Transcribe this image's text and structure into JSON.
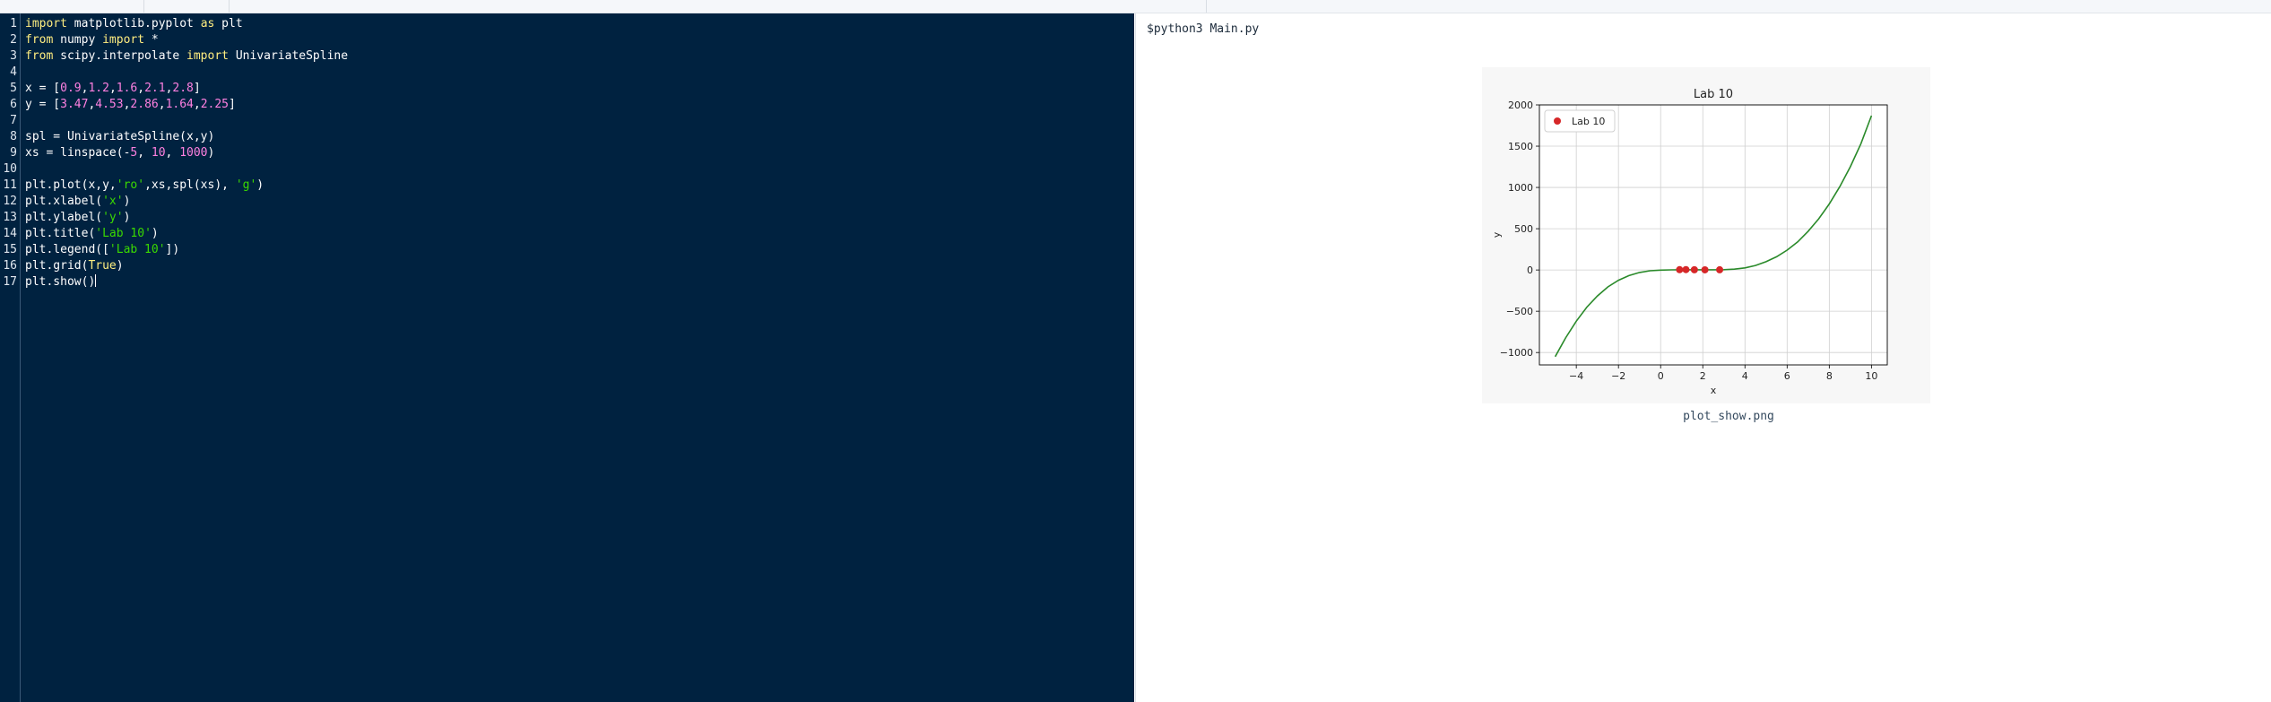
{
  "editor": {
    "lines": [
      [
        {
          "t": "import",
          "c": "kw"
        },
        {
          "t": " matplotlib.pyplot "
        },
        {
          "t": "as",
          "c": "kw"
        },
        {
          "t": " plt"
        }
      ],
      [
        {
          "t": "from",
          "c": "kw"
        },
        {
          "t": " numpy "
        },
        {
          "t": "import",
          "c": "kw"
        },
        {
          "t": " *"
        }
      ],
      [
        {
          "t": "from",
          "c": "kw"
        },
        {
          "t": " scipy.interpolate "
        },
        {
          "t": "import",
          "c": "kw"
        },
        {
          "t": " UnivariateSpline"
        }
      ],
      [],
      [
        {
          "t": "x = ["
        },
        {
          "t": "0.9",
          "c": "num"
        },
        {
          "t": ","
        },
        {
          "t": "1.2",
          "c": "num"
        },
        {
          "t": ","
        },
        {
          "t": "1.6",
          "c": "num"
        },
        {
          "t": ","
        },
        {
          "t": "2.1",
          "c": "num"
        },
        {
          "t": ","
        },
        {
          "t": "2.8",
          "c": "num"
        },
        {
          "t": "]"
        }
      ],
      [
        {
          "t": "y = ["
        },
        {
          "t": "3.47",
          "c": "num"
        },
        {
          "t": ","
        },
        {
          "t": "4.53",
          "c": "num"
        },
        {
          "t": ","
        },
        {
          "t": "2.86",
          "c": "num"
        },
        {
          "t": ","
        },
        {
          "t": "1.64",
          "c": "num"
        },
        {
          "t": ","
        },
        {
          "t": "2.25",
          "c": "num"
        },
        {
          "t": "]"
        }
      ],
      [],
      [
        {
          "t": "spl = UnivariateSpline(x,y)"
        }
      ],
      [
        {
          "t": "xs = linspace(-"
        },
        {
          "t": "5",
          "c": "num"
        },
        {
          "t": ", "
        },
        {
          "t": "10",
          "c": "num"
        },
        {
          "t": ", "
        },
        {
          "t": "1000",
          "c": "num"
        },
        {
          "t": ")"
        }
      ],
      [],
      [
        {
          "t": "plt.plot(x,y,"
        },
        {
          "t": "'ro'",
          "c": "str"
        },
        {
          "t": ",xs,spl(xs), "
        },
        {
          "t": "'g'",
          "c": "str"
        },
        {
          "t": ")"
        }
      ],
      [
        {
          "t": "plt.xlabel("
        },
        {
          "t": "'x'",
          "c": "str"
        },
        {
          "t": ")"
        }
      ],
      [
        {
          "t": "plt.ylabel("
        },
        {
          "t": "'y'",
          "c": "str"
        },
        {
          "t": ")"
        }
      ],
      [
        {
          "t": "plt.title("
        },
        {
          "t": "'Lab 10'",
          "c": "str"
        },
        {
          "t": ")"
        }
      ],
      [
        {
          "t": "plt.legend(["
        },
        {
          "t": "'Lab 10'",
          "c": "str"
        },
        {
          "t": "])"
        }
      ],
      [
        {
          "t": "plt.grid("
        },
        {
          "t": "True",
          "c": "kw"
        },
        {
          "t": ")"
        }
      ],
      [
        {
          "t": "plt.show()"
        }
      ]
    ]
  },
  "output": {
    "command": "$python3 Main.py",
    "image_caption": "plot_show.png"
  },
  "colors": {
    "editor_bg": "#002240",
    "keyword": "#ffee80",
    "number": "#ff80e1",
    "string": "#3ad900",
    "marker": "#d62728",
    "line": "#2a8a2a"
  },
  "chart_data": {
    "type": "line",
    "title": "Lab 10",
    "xlabel": "x",
    "ylabel": "y",
    "xlim": [
      -5.75,
      10.75
    ],
    "ylim": [
      -1150,
      2000
    ],
    "xticks": [
      -4,
      -2,
      0,
      2,
      4,
      6,
      8,
      10
    ],
    "xtick_labels": [
      "−4",
      "−2",
      "0",
      "2",
      "4",
      "6",
      "8",
      "10"
    ],
    "yticks": [
      -1000,
      -500,
      0,
      500,
      1000,
      1500,
      2000
    ],
    "ytick_labels": [
      "−1000",
      "−500",
      "0",
      "500",
      "1000",
      "1500",
      "2000"
    ],
    "grid": true,
    "legend": {
      "position": "top-left",
      "entries": [
        "Lab 10"
      ]
    },
    "series": [
      {
        "name": "Lab 10",
        "style": "markers",
        "x": [
          0.9,
          1.2,
          1.6,
          2.1,
          2.8
        ],
        "y": [
          3.47,
          4.53,
          2.86,
          1.64,
          2.25
        ]
      },
      {
        "style": "line",
        "x": [
          -5,
          -4.5,
          -4,
          -3.5,
          -3,
          -2.5,
          -2,
          -1.5,
          -1,
          -0.5,
          0,
          0.5,
          1,
          1.5,
          2,
          2.5,
          3,
          3.5,
          4,
          4.5,
          5,
          5.5,
          6,
          6.5,
          7,
          7.5,
          8,
          8.5,
          9,
          9.5,
          10
        ],
        "y": [
          -1050,
          -820,
          -620,
          -450,
          -315,
          -205,
          -125,
          -68,
          -30,
          -10,
          -2,
          1,
          3,
          3,
          2,
          2,
          4,
          10,
          25,
          55,
          100,
          160,
          240,
          340,
          470,
          620,
          800,
          1010,
          1250,
          1530,
          1870
        ]
      }
    ]
  }
}
